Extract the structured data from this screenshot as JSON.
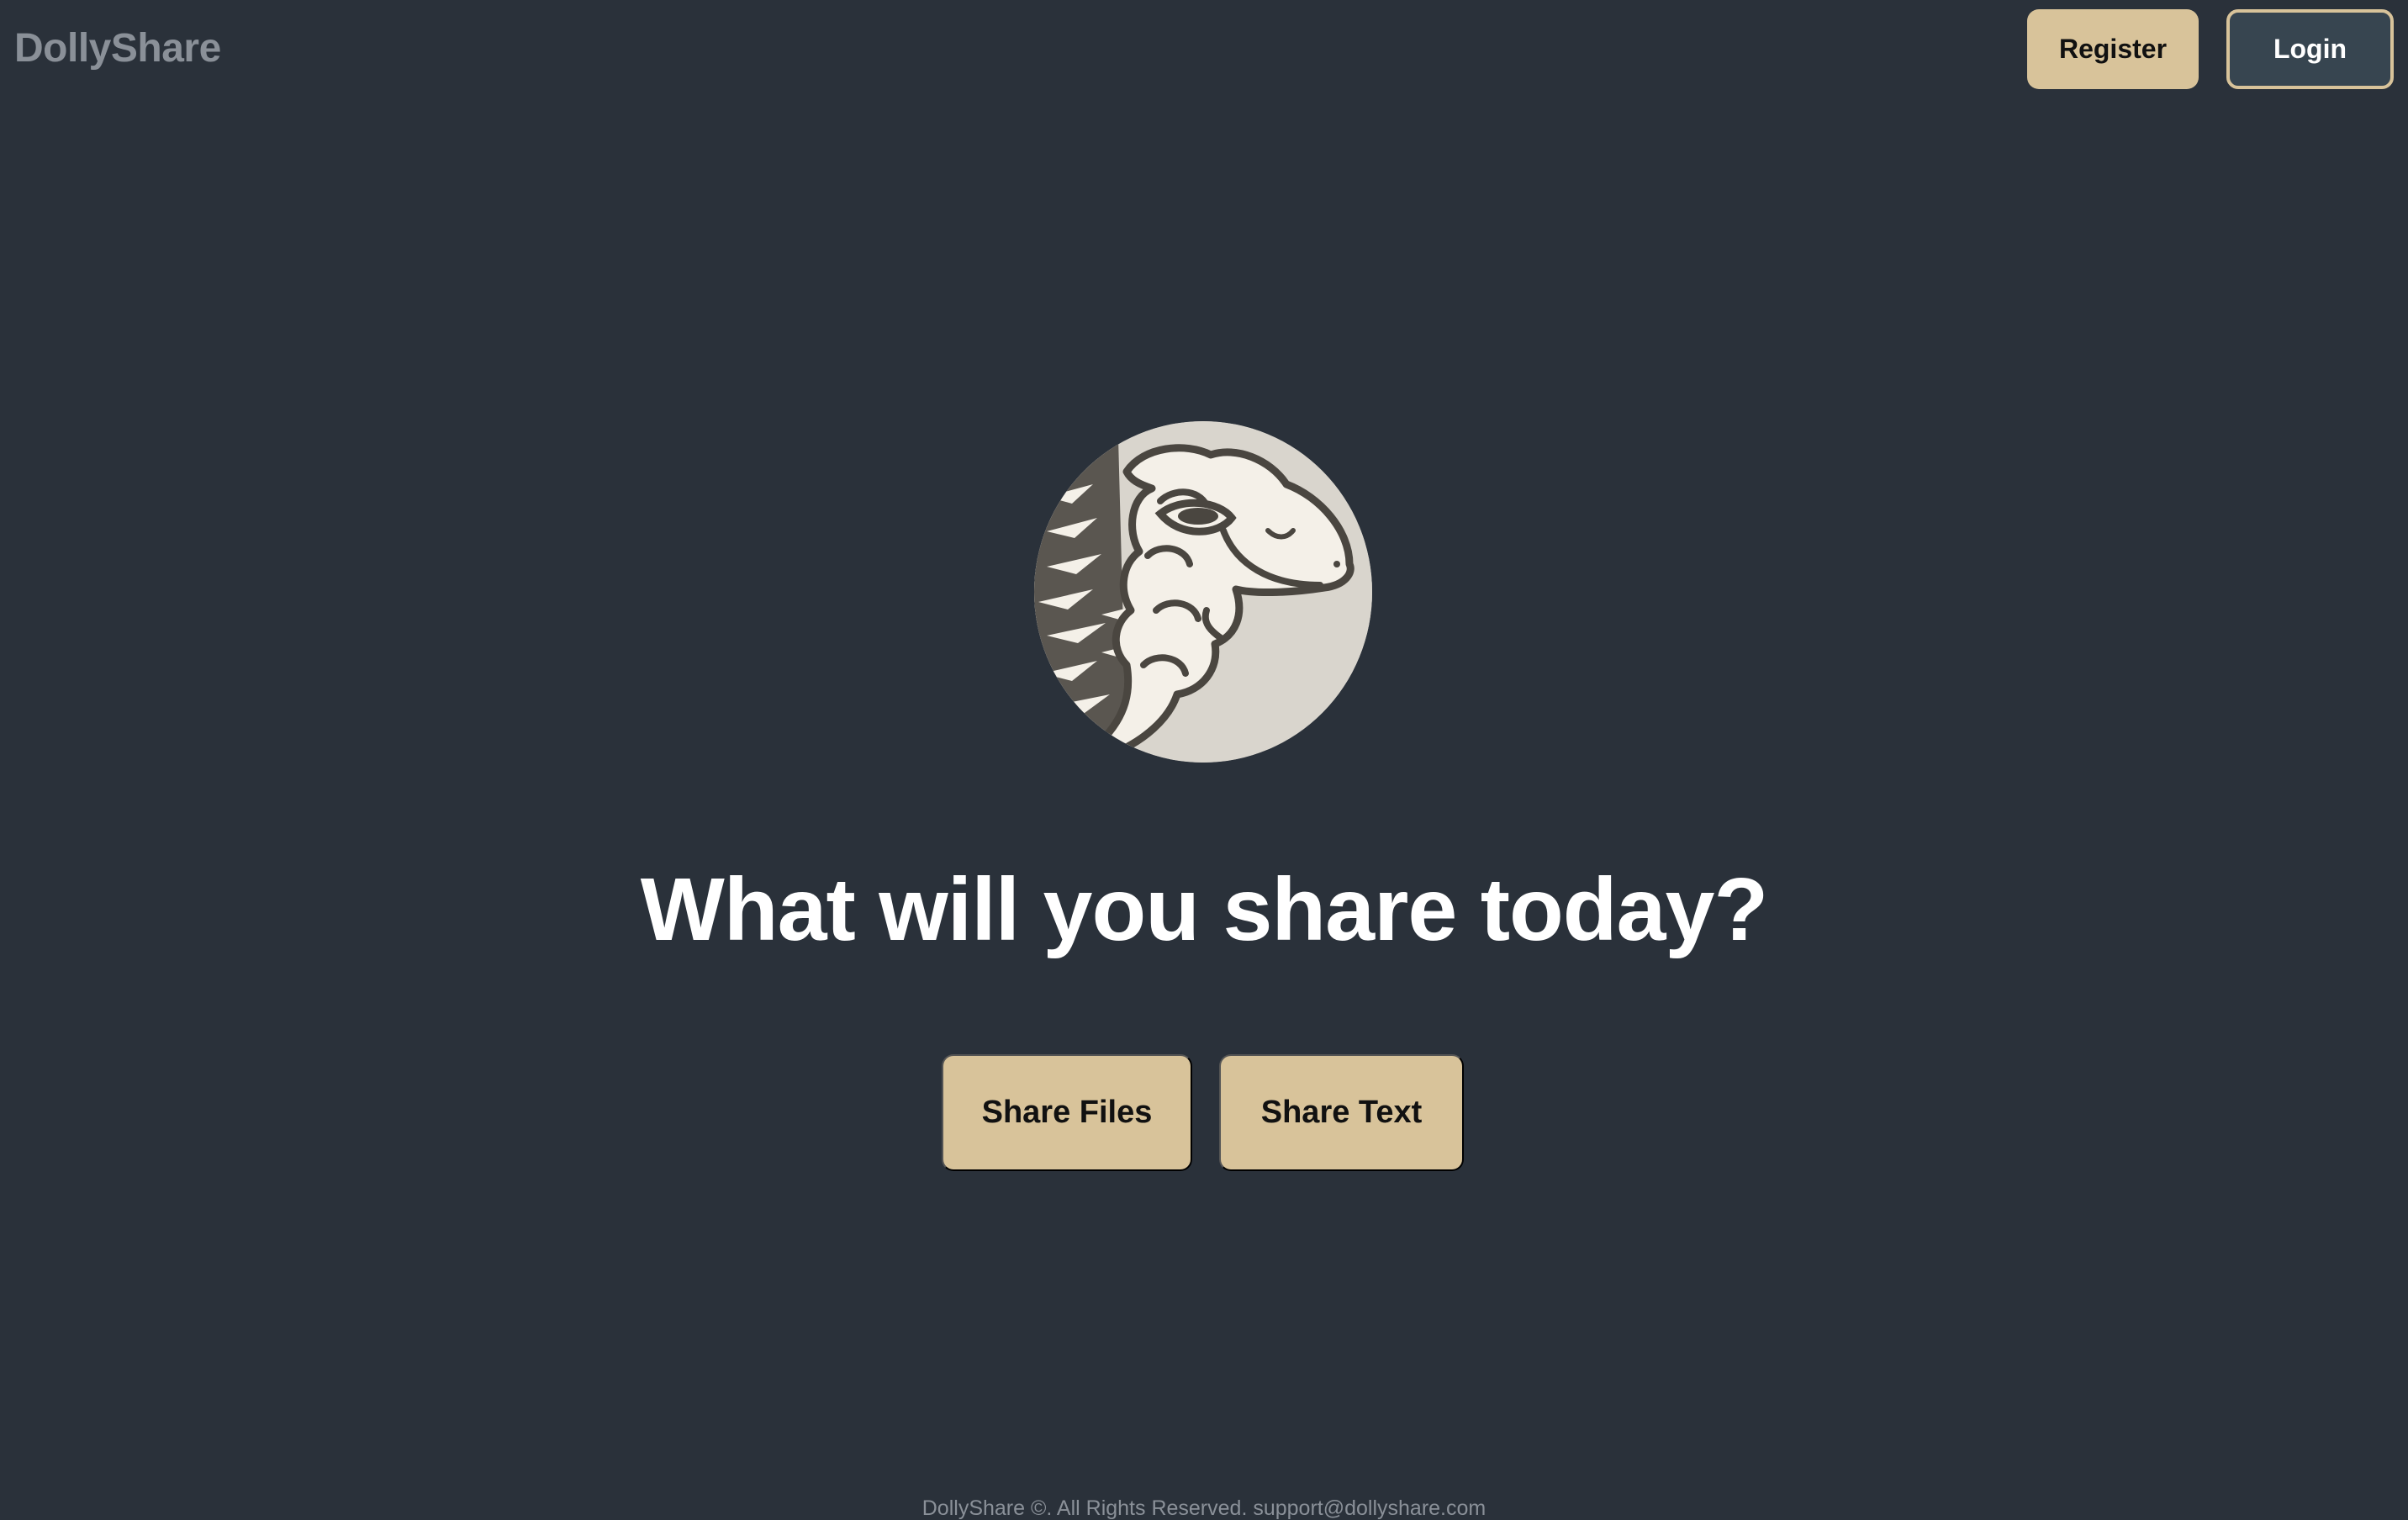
{
  "header": {
    "brand": "DollyShare",
    "register_label": "Register",
    "login_label": "Login"
  },
  "hero": {
    "logo_icon": "sheep-logo-icon",
    "headline": "What will you share today?",
    "share_files_label": "Share Files",
    "share_text_label": "Share Text"
  },
  "footer": {
    "text": "DollyShare ©. All Rights Reserved. support@dollyshare.com"
  },
  "colors": {
    "background": "#2a313a",
    "accent": "#d8c39a",
    "login_bg": "#374550",
    "muted_text": "#8a9098"
  }
}
